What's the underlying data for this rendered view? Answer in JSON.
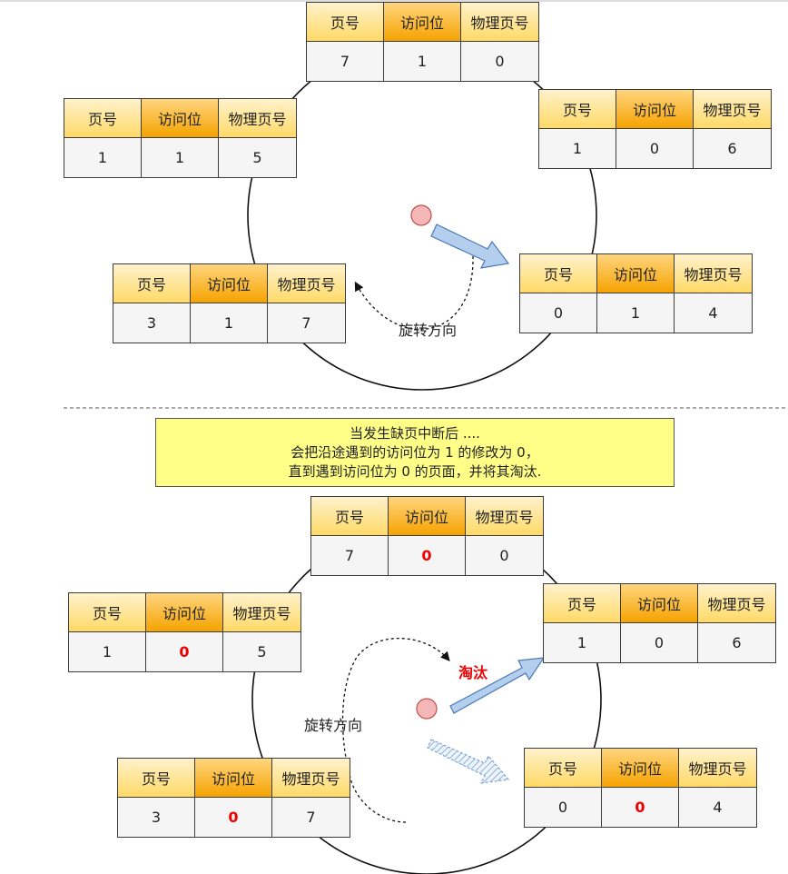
{
  "headers": {
    "page": "页号",
    "access": "访问位",
    "frame": "物理页号"
  },
  "top_diagram": {
    "direction_label": "旋转方向",
    "entries": [
      {
        "page": "7",
        "access": "1",
        "frame": "0"
      },
      {
        "page": "1",
        "access": "0",
        "frame": "6"
      },
      {
        "page": "0",
        "access": "1",
        "frame": "4"
      },
      {
        "page": "3",
        "access": "1",
        "frame": "7"
      },
      {
        "page": "1",
        "access": "1",
        "frame": "5"
      }
    ]
  },
  "note": {
    "line1": "当发生缺页中断后 ....",
    "line2": "会把沿途遇到的访问位为  1 的修改为 0，",
    "line3": "直到遇到访问位为 0 的页面，并将其淘汰."
  },
  "bottom_diagram": {
    "direction_label": "旋转方向",
    "evict_label": "淘汰",
    "entries": [
      {
        "page": "7",
        "access": "0",
        "frame": "0",
        "modified": true
      },
      {
        "page": "1",
        "access": "0",
        "frame": "6",
        "modified": false
      },
      {
        "page": "0",
        "access": "0",
        "frame": "4",
        "modified": true
      },
      {
        "page": "3",
        "access": "0",
        "frame": "7",
        "modified": true
      },
      {
        "page": "1",
        "access": "0",
        "frame": "5",
        "modified": true
      }
    ]
  },
  "colors": {
    "header": "#ffd966",
    "header_access": "#f5a300",
    "modified_value": "#ee0000",
    "note_bg": "#ffff88",
    "arrow_fill": "#b4cfee",
    "hand": "#f4b6b6"
  }
}
